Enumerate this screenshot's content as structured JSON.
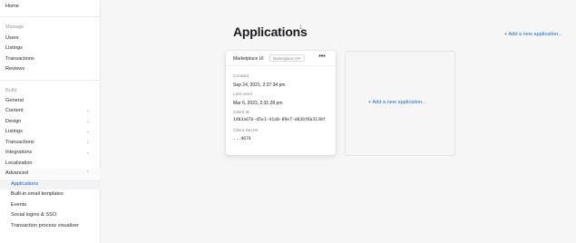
{
  "sidebar": {
    "home": "Home",
    "manage_header": "Manage",
    "manage_items": [
      "Users",
      "Listings",
      "Transactions",
      "Reviews"
    ],
    "build_header": "Build",
    "build_items": {
      "general": "General",
      "content": "Content",
      "design": "Design",
      "listings": "Listings",
      "transactions": "Transactions",
      "integrations": "Integrations",
      "localization": "Localization",
      "advanced": "Advanced"
    },
    "advanced_items": [
      "Applications",
      "Built-in email templates",
      "Events",
      "Social logins & SSO",
      "Transaction process visualizer"
    ]
  },
  "main": {
    "title": "Applications",
    "title_badge": "1",
    "add_link": "+ Add a new application..."
  },
  "app_card": {
    "name": "Marketplace UI",
    "tag": "Marketplace API",
    "menu_label": "•••",
    "created_label": "Created",
    "created_value": "Sep 24, 2021, 2:37:34 pm",
    "last_used_label": "Last used",
    "last_used_value": "Mar 6, 2023, 2:31:28 pm",
    "client_id_label": "Client ID",
    "client_id_value": "1483a67b-d5e1-41a0-89e7-d836f8a3138f",
    "client_secret_label": "Client Secret",
    "client_secret_value": "...d674"
  },
  "empty_card": {
    "add_link": "+ Add a new application..."
  },
  "colors": {
    "accent": "#1f6fd6",
    "background": "#f6f6f7"
  },
  "icons": {
    "chevron": "chevron-down-icon",
    "chevron_up": "chevron-up-icon",
    "more": "more-horizontal-icon"
  }
}
